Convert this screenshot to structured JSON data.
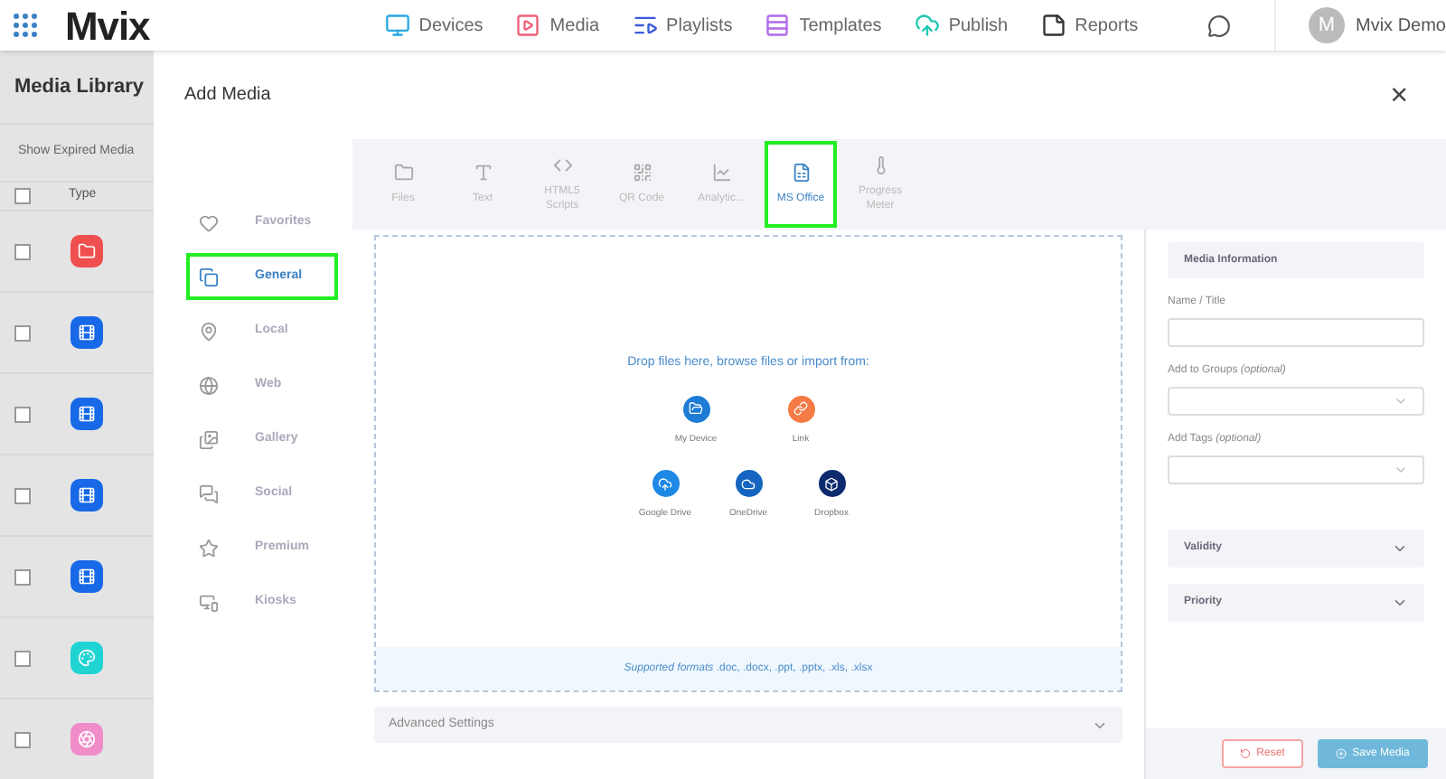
{
  "brand": {
    "logo": "Mvix"
  },
  "nav": [
    {
      "label": "Devices",
      "color": "#29a9e0"
    },
    {
      "label": "Media",
      "color": "#f0607a"
    },
    {
      "label": "Playlists",
      "color": "#3b5bdb"
    },
    {
      "label": "Templates",
      "color": "#b06ae8"
    },
    {
      "label": "Publish",
      "color": "#20c9b0"
    },
    {
      "label": "Reports",
      "color": "#333333"
    }
  ],
  "user": {
    "avatar": "M",
    "name": "Mvix Demo"
  },
  "library": {
    "title": "Media Library",
    "filter": "Show Expired Media",
    "column": "Type",
    "all_checked": false,
    "rows": [
      {
        "checked": false,
        "color": "#ef4f4f"
      },
      {
        "checked": false,
        "color": "#1769e8"
      },
      {
        "checked": false,
        "color": "#1769e8"
      },
      {
        "checked": false,
        "color": "#1769e8"
      },
      {
        "checked": false,
        "color": "#1769e8"
      },
      {
        "checked": false,
        "color": "#1fd3d3"
      },
      {
        "checked": false,
        "color": "#f08cc8"
      }
    ]
  },
  "dialog": {
    "title": "Add Media",
    "close": "×",
    "categories": [
      {
        "label": "Favorites",
        "selected": false,
        "highlighted": false
      },
      {
        "label": "General",
        "selected": true,
        "highlighted": true
      },
      {
        "label": "Local",
        "selected": false,
        "highlighted": false
      },
      {
        "label": "Web",
        "selected": false,
        "highlighted": false
      },
      {
        "label": "Gallery",
        "selected": false,
        "highlighted": false
      },
      {
        "label": "Social",
        "selected": false,
        "highlighted": false
      },
      {
        "label": "Premium",
        "selected": false,
        "highlighted": false
      },
      {
        "label": "Kiosks",
        "selected": false,
        "highlighted": false
      }
    ],
    "types": [
      {
        "label": "Files",
        "selected": false,
        "highlighted": false
      },
      {
        "label": "Text",
        "selected": false,
        "highlighted": false
      },
      {
        "label": "HTML5 Scripts",
        "selected": false,
        "highlighted": false
      },
      {
        "label": "QR Code",
        "selected": false,
        "highlighted": false
      },
      {
        "label": "Analytic...",
        "selected": false,
        "highlighted": false
      },
      {
        "label": "MS Office",
        "selected": true,
        "highlighted": true
      },
      {
        "label": "Progress Meter",
        "selected": false,
        "highlighted": false
      }
    ],
    "dropzone": {
      "prompt": "Drop files here, browse files or import from:",
      "sources": [
        {
          "label": "My Device",
          "color": "#1e7bd6"
        },
        {
          "label": "Link",
          "color": "#f47b45"
        }
      ],
      "cloud_sources": [
        {
          "label": "Google Drive",
          "color": "#1e88e5"
        },
        {
          "label": "OneDrive",
          "color": "#1565c0"
        },
        {
          "label": "Dropbox",
          "color": "#0d2a6e"
        }
      ],
      "formats": "*Supported formats* .doc, .docx, .ppt, .pptx, .xls, .xlsx"
    },
    "advanced": "Advanced Settings",
    "info": {
      "header": "Media Information",
      "fields": [
        {
          "label": "Name / Title",
          "kind": "text"
        },
        {
          "label": "Add to Groups *(optional)*",
          "kind": "select"
        },
        {
          "label": "Add Tags *(optional)*",
          "kind": "select"
        }
      ],
      "sections": [
        {
          "label": "Validity",
          "expanded": false
        },
        {
          "label": "Priority",
          "expanded": false
        }
      ]
    },
    "buttons": [
      {
        "label": "Reset",
        "kind": "reset"
      },
      {
        "label": "Save Media",
        "kind": "save"
      }
    ]
  }
}
